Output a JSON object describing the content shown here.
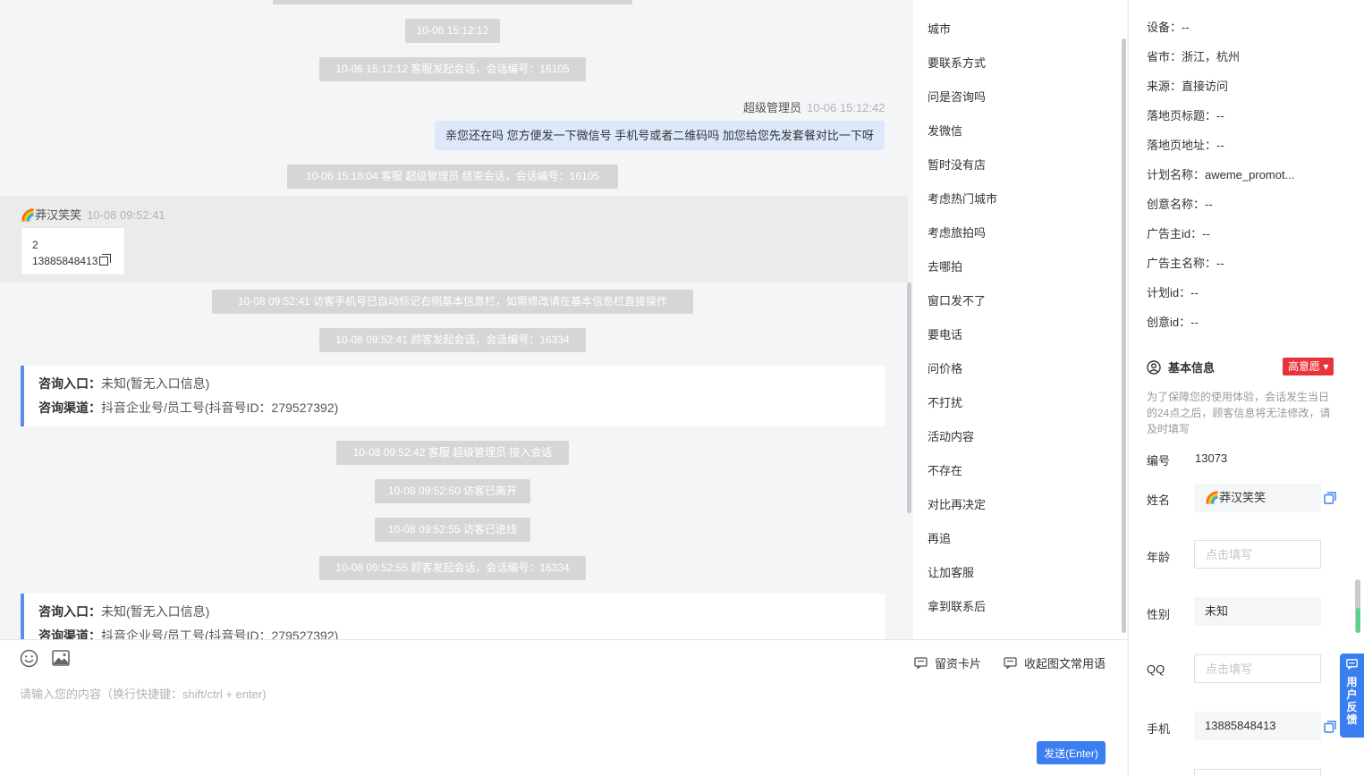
{
  "chat": {
    "events": [
      "10-06 15:12:12",
      "10-06 15:12:12 客服发起会话，会话编号：16105",
      "10-06 15:18:04 客服 超级管理员 结束会话，会话编号：16105",
      "10-08 09:52:41 访客手机号已自动标记右侧基本信息栏，如需修改请在基本信息栏直接操作",
      "10-08 09:52:41 顾客发起会话，会话编号：16334",
      "10-08 09:52:42 客服 超级管理员 接入会话",
      "10-08 09:52:50 访客已离开",
      "10-08 09:52:55 访客已进线",
      "10-08 09:52:55 顾客发起会话，会话编号：16334"
    ],
    "agent_name": "超级管理员",
    "agent_time": "10-06 15:12:42",
    "agent_message": "亲您还在吗 您方便发一下微信号 手机号或者二维码吗 加您给您先发套餐对比一下呀",
    "visitor_name": "🌈莽汉笑笑",
    "visitor_time": "10-08 09:52:41",
    "visitor_msg_line1": "2",
    "visitor_msg_line2": "13885848413",
    "info_box_1": {
      "entry_label": "咨询入口：",
      "entry_value": "未知(暂无入口信息)",
      "channel_label": "咨询渠道：",
      "channel_value": "抖音企业号/员工号(抖音号ID：279527392)"
    },
    "info_box_2": {
      "entry_label": "咨询入口：",
      "entry_value": "未知(暂无入口信息)",
      "channel_label": "咨询渠道：",
      "channel_value": "抖音企业号/员工号(抖音号ID：279527392)"
    }
  },
  "phrases": [
    "城市",
    "要联系方式",
    "问是咨询吗",
    "发微信",
    "暂时没有店",
    "考虑热门城市",
    "考虑旅拍吗",
    "去哪拍",
    "窗口发不了",
    "要电话",
    "问价格",
    "不打扰",
    "活动内容",
    "不存在",
    "对比再决定",
    "再追",
    "让加客服",
    "拿到联系后"
  ],
  "input": {
    "placeholder": "请输入您的内容（换行快捷键：shift/ctrl + enter)",
    "card_link": "留资卡片",
    "collapse_link": "收起图文常用语",
    "send_label": "发送(Enter)"
  },
  "panel": {
    "kv": [
      "设备：--",
      "省市：浙江，杭州",
      "来源：直接访问",
      "落地页标题：--",
      "落地页地址：--",
      "计划名称：aweme_promot...",
      "创意名称：--",
      "广告主id：--",
      "广告主名称：--",
      "计划id：--",
      "创意id：--"
    ],
    "section_title": "基本信息",
    "intent_tag": "高意愿 ▾",
    "tip": "为了保障您的使用体验，会话发生当日的24点之后，顾客信息将无法修改，请及时填写",
    "fields": {
      "id_label": "编号",
      "id_value": "13073",
      "name_label": "姓名",
      "name_value": "🌈莽汉笑笑",
      "age_label": "年龄",
      "age_placeholder": "点击填写",
      "gender_label": "性别",
      "gender_value": "未知",
      "qq_label": "QQ",
      "qq_placeholder": "点击填写",
      "phone_label": "手机",
      "phone_value": "13885848413"
    },
    "feedback_label": "用户反馈"
  },
  "colors": {
    "accent": "#3b7ef0",
    "tag": "#e8333d",
    "pill": "#d5d6d8",
    "bubble": "#dde9fb"
  }
}
